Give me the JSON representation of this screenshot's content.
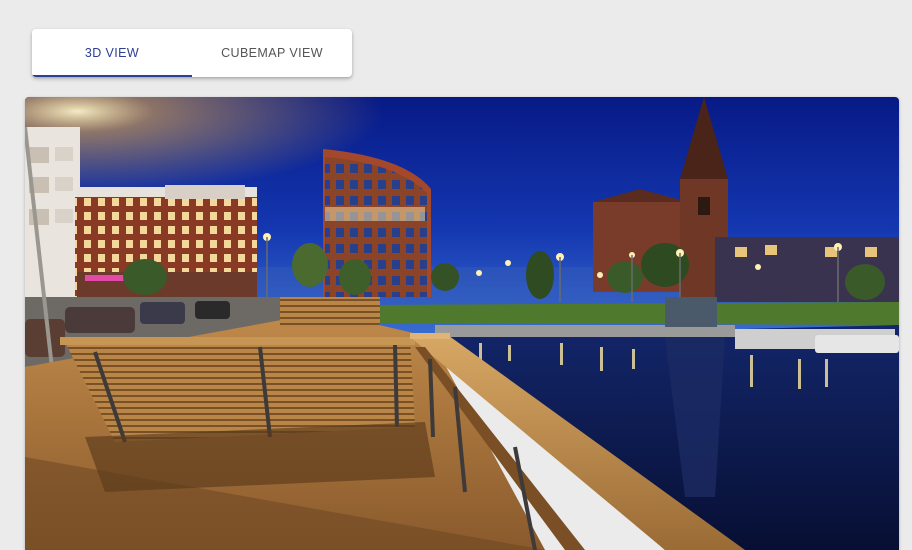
{
  "tabs": [
    {
      "label": "3D VIEW",
      "active": true
    },
    {
      "label": "CUBEMAP VIEW",
      "active": false
    }
  ],
  "colors": {
    "accent": "#2b3f93",
    "tab_inactive": "#555555",
    "background": "#ebebeb",
    "sky_top": "#0a1f8c",
    "sky_horizon": "#2a5fc4",
    "water": "#0b1a4a"
  }
}
